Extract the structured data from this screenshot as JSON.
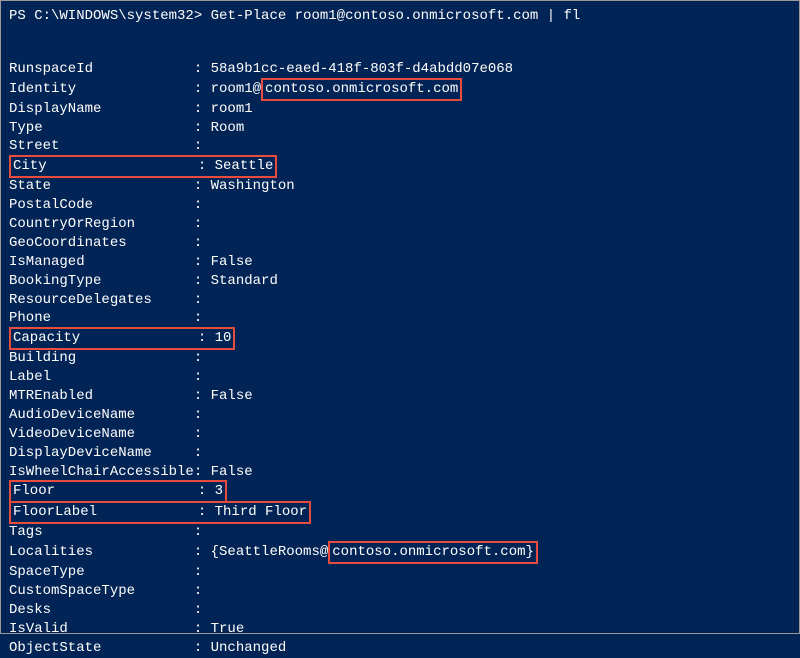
{
  "prompt": {
    "prefix": "PS C:\\WINDOWS\\system32> ",
    "command": "Get-Place room1@contoso.onmicrosoft.com | fl"
  },
  "rows": [
    {
      "key": "RunspaceId",
      "value": "58a9b1cc-eaed-418f-803f-d4abdd07e068",
      "keyHi": false,
      "valHi": false
    },
    {
      "key": "Identity",
      "value_prefix": "room1@",
      "value_hi": "contoso.onmicrosoft.com",
      "keyHi": false,
      "valSplit": true
    },
    {
      "key": "DisplayName",
      "value": "room1",
      "keyHi": false,
      "valHi": false
    },
    {
      "key": "Type",
      "value": "Room",
      "keyHi": false,
      "valHi": false
    },
    {
      "key": "Street",
      "value": "",
      "keyHi": false,
      "valHi": false
    },
    {
      "key": "City",
      "value": "Seattle",
      "keyHi": true,
      "valHi": true,
      "combined": true
    },
    {
      "key": "State",
      "value": "Washington",
      "keyHi": false,
      "valHi": false
    },
    {
      "key": "PostalCode",
      "value": "",
      "keyHi": false,
      "valHi": false
    },
    {
      "key": "CountryOrRegion",
      "value": "",
      "keyHi": false,
      "valHi": false
    },
    {
      "key": "GeoCoordinates",
      "value": "",
      "keyHi": false,
      "valHi": false
    },
    {
      "key": "IsManaged",
      "value": "False",
      "keyHi": false,
      "valHi": false
    },
    {
      "key": "BookingType",
      "value": "Standard",
      "keyHi": false,
      "valHi": false
    },
    {
      "key": "ResourceDelegates",
      "value": "",
      "keyHi": false,
      "valHi": false
    },
    {
      "key": "Phone",
      "value": "",
      "keyHi": false,
      "valHi": false
    },
    {
      "key": "Capacity",
      "value": "10",
      "keyHi": true,
      "valHi": true,
      "combined": true
    },
    {
      "key": "Building",
      "value": "",
      "keyHi": false,
      "valHi": false
    },
    {
      "key": "Label",
      "value": "",
      "keyHi": false,
      "valHi": false
    },
    {
      "key": "MTREnabled",
      "value": "False",
      "keyHi": false,
      "valHi": false
    },
    {
      "key": "AudioDeviceName",
      "value": "",
      "keyHi": false,
      "valHi": false
    },
    {
      "key": "VideoDeviceName",
      "value": "",
      "keyHi": false,
      "valHi": false
    },
    {
      "key": "DisplayDeviceName",
      "value": "",
      "keyHi": false,
      "valHi": false
    },
    {
      "key": "IsWheelChairAccessible",
      "value": "False",
      "keyHi": false,
      "valHi": false,
      "wide": true
    },
    {
      "key": "Floor",
      "value": "3",
      "keyHi": true,
      "valHi": true,
      "combined": true,
      "group": "floor"
    },
    {
      "key": "FloorLabel",
      "value": "Third Floor",
      "keyHi": true,
      "valHi": true,
      "combined": true,
      "group": "floor"
    },
    {
      "key": "Tags",
      "value": "",
      "keyHi": false,
      "valHi": false
    },
    {
      "key": "Localities",
      "value_prefix": "{SeattleRooms@",
      "value_hi": "contoso.onmicrosoft.com}",
      "keyHi": false,
      "valSplit": true
    },
    {
      "key": "SpaceType",
      "value": "",
      "keyHi": false,
      "valHi": false
    },
    {
      "key": "CustomSpaceType",
      "value": "",
      "keyHi": false,
      "valHi": false
    },
    {
      "key": "Desks",
      "value": "",
      "keyHi": false,
      "valHi": false
    },
    {
      "key": "IsValid",
      "value": "True",
      "keyHi": false,
      "valHi": false
    },
    {
      "key": "ObjectState",
      "value": "Unchanged",
      "keyHi": false,
      "valHi": false
    }
  ]
}
